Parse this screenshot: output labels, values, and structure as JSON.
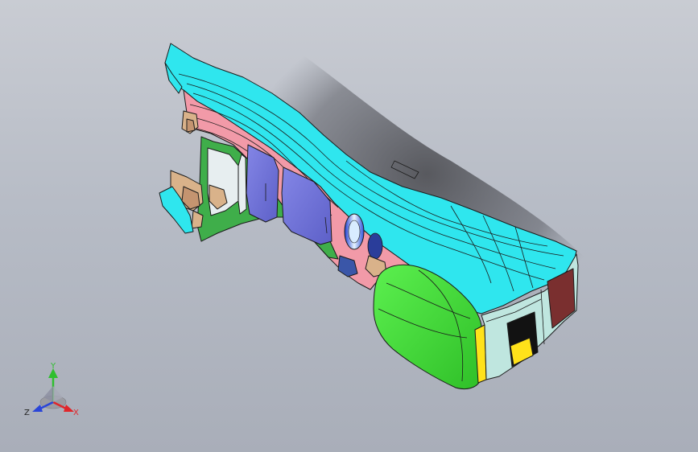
{
  "triad": {
    "x_label": "X",
    "y_label": "Y",
    "z_label": "Z",
    "x_color": "#e0262b",
    "y_color": "#2fbf2f",
    "z_color": "#2a45d8"
  },
  "model": {
    "colors": {
      "top_cover": "#2fe6ee",
      "side_panel": "#f29aa8",
      "inner_frame": "#3fae4a",
      "door_panels": "#6f71d6",
      "end_cap": "#46e23c",
      "end_trim": "#bfe6df",
      "rear_panel": "#7a2f2f",
      "vent": "#ffe21a",
      "bracket": "#d9b28a",
      "edge": "#1b1b1b"
    }
  }
}
